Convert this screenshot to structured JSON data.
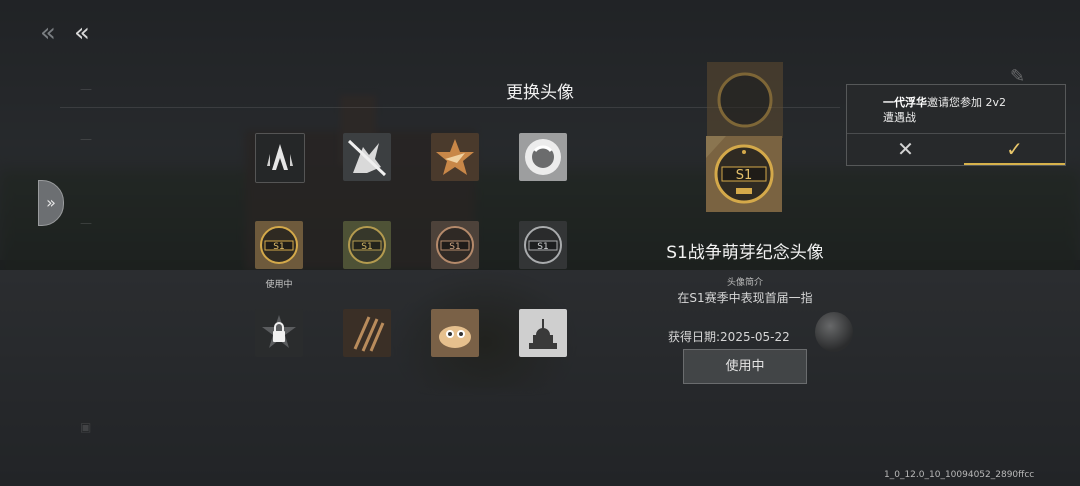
{
  "nav": {
    "back_glyph": "≪",
    "back_icon": "double-chevron-left-icon"
  },
  "dialog": {
    "title": "更换头像",
    "in_use_label": "使用中"
  },
  "avatars": [
    {
      "id": "a1",
      "icon": "shield-emblem"
    },
    {
      "id": "a2",
      "icon": "wolf-head"
    },
    {
      "id": "a3",
      "icon": "star-eagle"
    },
    {
      "id": "a4",
      "icon": "bear-mascot"
    },
    {
      "id": "a5",
      "icon": "s1-badge-gold",
      "selected": true
    },
    {
      "id": "a6",
      "icon": "s1-badge-green"
    },
    {
      "id": "a7",
      "icon": "s1-badge-bronze"
    },
    {
      "id": "a8",
      "icon": "s1-badge-silver"
    },
    {
      "id": "a9",
      "icon": "locked-star"
    },
    {
      "id": "a10",
      "icon": "claw-scratch"
    },
    {
      "id": "a11",
      "icon": "fish-pilot"
    },
    {
      "id": "a12",
      "icon": "capitol-building"
    }
  ],
  "detail": {
    "name": "S1战争萌芽纪念头像",
    "intro_label": "头像简介",
    "intro_text": "在S1赛季中表现首届一指",
    "obtained_date": "获得日期:2025-05-22",
    "use_button": "使用中"
  },
  "invite": {
    "inviter": "一代浮华",
    "message": "邀请您参加 2v2",
    "mode": "遭遇战",
    "decline_glyph": "✕",
    "accept_glyph": "✓"
  },
  "version": "1_0_12.0_10_10094052_2890ffcc",
  "colors": {
    "accent_gold": "#d7b24c",
    "panel": "#2a2c2e"
  }
}
